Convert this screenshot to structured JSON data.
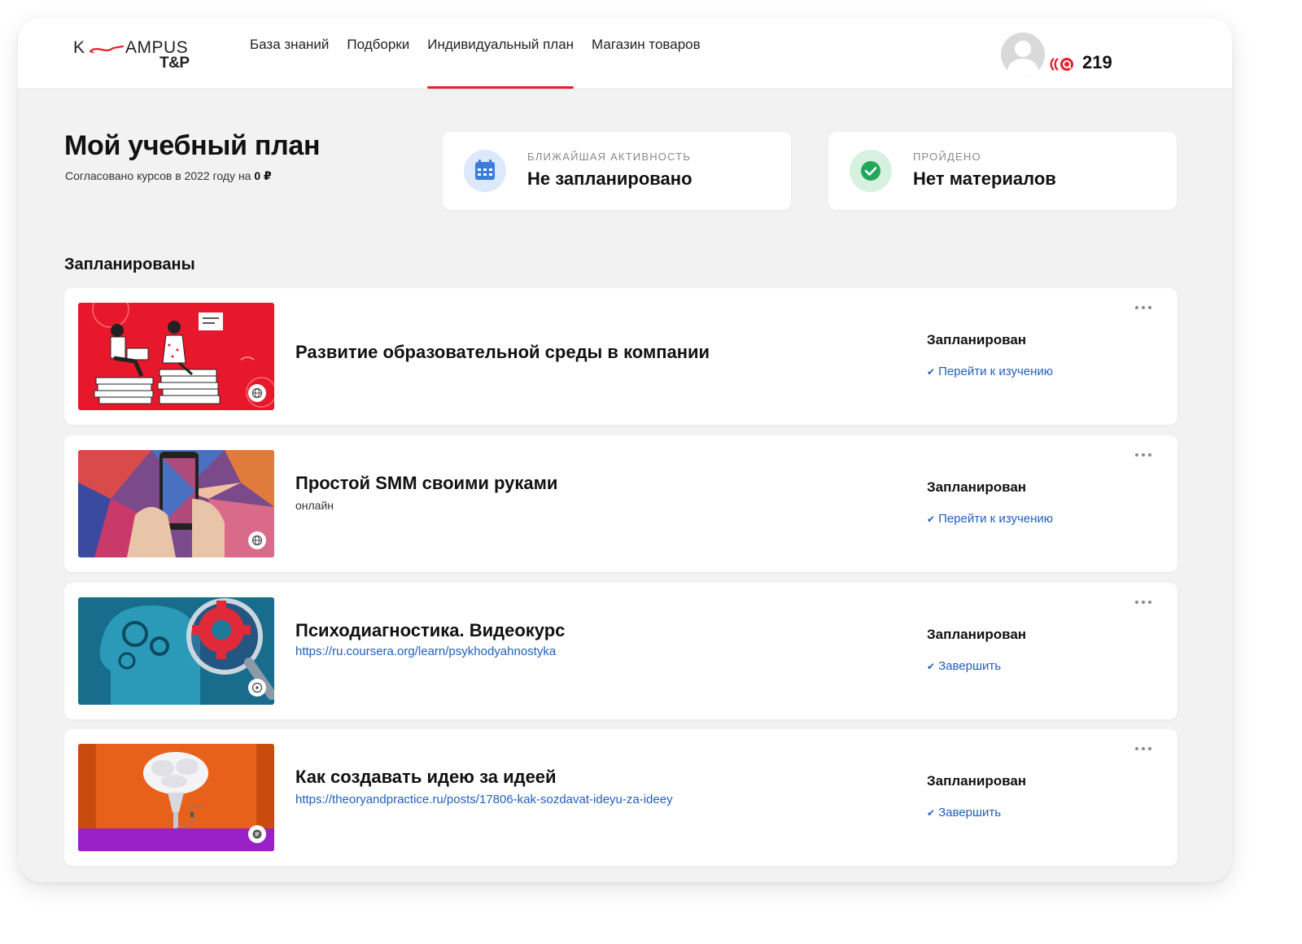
{
  "colors": {
    "accent": "#e8202a",
    "link": "#1f5fbf",
    "background": "#f2f2f2"
  },
  "logo": {
    "part1": "K",
    "part2": "AMPUS",
    "part3": "T&P"
  },
  "nav": [
    {
      "label": "База знаний"
    },
    {
      "label": "Подборки"
    },
    {
      "label": "Индивидуальный план",
      "active": true
    },
    {
      "label": "Магазин товаров"
    }
  ],
  "user": {
    "coins": "219",
    "avatar_icon": "user-avatar-icon",
    "coin_icon": "coin-icon"
  },
  "page": {
    "title": "Мой учебный план",
    "budget_text": "Согласовано курсов в 2022 году на ",
    "budget_value": "0 ₽"
  },
  "cards": {
    "next_activity": {
      "caption": "Ближайшая активность",
      "value": "Не запланировано",
      "icon": "calendar-icon"
    },
    "completed": {
      "caption": "Пройдено",
      "value": "Нет материалов",
      "icon": "check-circle-icon"
    }
  },
  "section": {
    "title": "Запланированы"
  },
  "courses": [
    {
      "title": "Развитие образовательной среды в компании",
      "subtitle": "",
      "link": "",
      "status": "Запланирован",
      "action": "Перейти к изучению",
      "badge_icon": "globe-icon"
    },
    {
      "title": "Простой SMM своими руками",
      "subtitle": "онлайн",
      "link": "",
      "status": "Запланирован",
      "action": "Перейти к изучению",
      "badge_icon": "globe-icon"
    },
    {
      "title": "Психодиагностика. Видеокурс",
      "subtitle": "",
      "link": "https://ru.coursera.org/learn/psykhodyahnostyka",
      "status": "Запланирован",
      "action": "Завершить",
      "badge_icon": "play-icon"
    },
    {
      "title": "Как создавать идею за идеей",
      "subtitle": "",
      "link": "https://theoryandpractice.ru/posts/17806-kak-sozdavat-ideyu-za-ideey",
      "status": "Запланирован",
      "action": "Завершить",
      "badge_icon": "article-icon"
    }
  ]
}
